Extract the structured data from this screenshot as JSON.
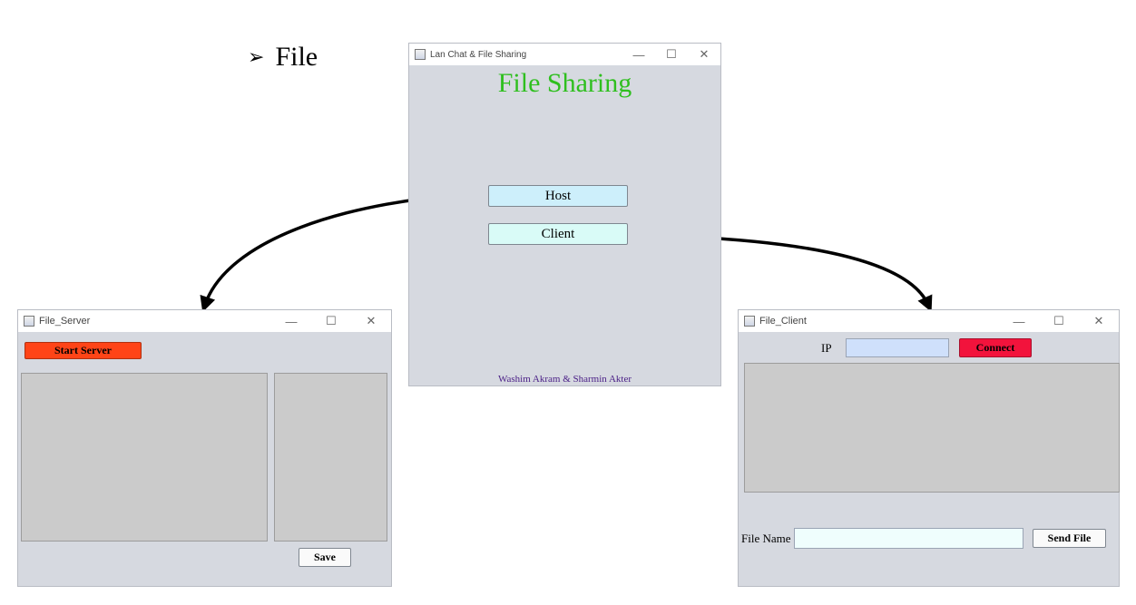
{
  "heading": {
    "bullet": "➢",
    "text": "File"
  },
  "main_window": {
    "title": "Lan Chat & File Sharing",
    "header": "File Sharing",
    "header_color": "#2fbf1f",
    "host_label": "Host",
    "client_label": "Client",
    "footer": "Washim Akram & Sharmin Akter",
    "footer_color": "#4a1f86"
  },
  "server_window": {
    "title": "File_Server",
    "start_label": "Start Server",
    "start_color": "#ff4417",
    "save_label": "Save"
  },
  "client_window": {
    "title": "File_Client",
    "ip_label": "IP",
    "ip_value": "",
    "connect_label": "Connect",
    "connect_color": "#f2133c",
    "file_name_label": "File Name",
    "file_name_value": "",
    "send_label": "Send File"
  },
  "window_controls": {
    "minimize": "—",
    "maximize": "☐",
    "close": "✕"
  }
}
